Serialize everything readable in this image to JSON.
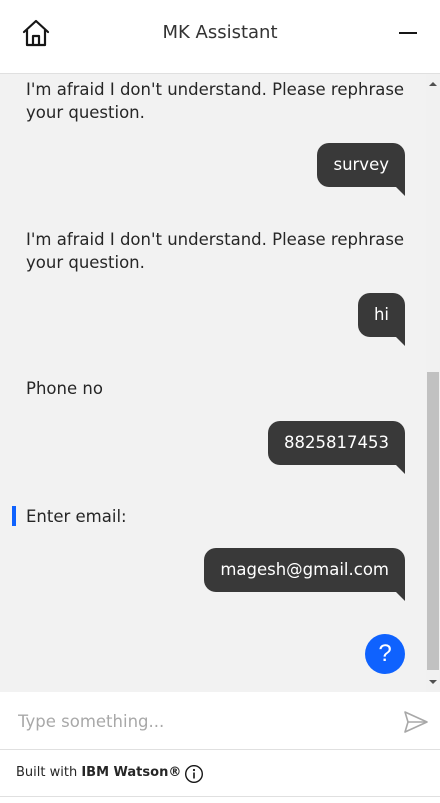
{
  "header": {
    "title": "MK Assistant",
    "home_icon": "home-icon",
    "minimize_icon": "minimize-icon"
  },
  "messages": [
    {
      "from": "bot",
      "text": "I'm afraid I don't understand. Please rephrase your question."
    },
    {
      "from": "user",
      "text": "survey"
    },
    {
      "from": "bot",
      "text": "I'm afraid I don't understand. Please rephrase your question."
    },
    {
      "from": "user",
      "text": "hi"
    },
    {
      "from": "bot",
      "text": "Phone no"
    },
    {
      "from": "user",
      "text": "8825817453"
    },
    {
      "from": "bot",
      "text": "Enter email:"
    },
    {
      "from": "user",
      "text": "magesh@gmail.com"
    }
  ],
  "help_button": {
    "label": "?"
  },
  "input": {
    "placeholder": "Type something...",
    "value": ""
  },
  "footer": {
    "prefix": "Built with ",
    "brand": "IBM Watson®"
  },
  "colors": {
    "accent": "#0f62fe",
    "user_bubble": "#393939",
    "chat_bg": "#f2f2f2"
  }
}
